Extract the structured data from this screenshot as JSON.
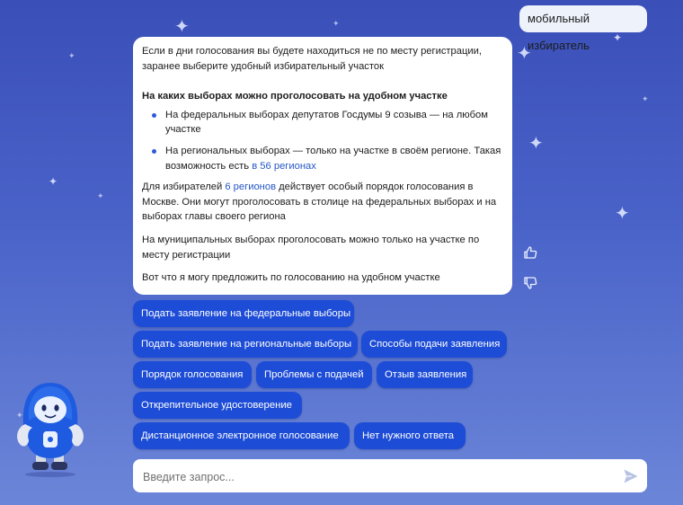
{
  "user_message": "мобильный избиратель",
  "bot_message": {
    "intro": "Если в дни голосования вы будете находиться не по месту регистрации, заранее выберите удобный избирательный участок",
    "subheading": "На каких выборах можно проголосовать на удобном участке",
    "bullets": [
      {
        "text": "На федеральных выборах депутатов Госдумы 9 созыва — на любом участке"
      },
      {
        "text": "На региональных выборах — только на участке в своём регионе. Такая возможность есть ",
        "link": "в 56 регионах"
      }
    ],
    "para1_before": "Для избирателей ",
    "para1_link": "6 регионов",
    "para1_after": " действует особый порядок голосования в Москве. Они могут проголосовать в столице на федеральных выборах и на выборах главы своего региона",
    "para2": "На муниципальных выборах проголосовать можно только на участке по месту регистрации",
    "para3": "Вот что я могу предложить по голосованию на удобном участке"
  },
  "suggestions": [
    "Подать заявление на федеральные выборы",
    "Подать заявление на региональные выборы",
    "Способы подачи заявления",
    "Порядок голосования",
    "Проблемы с подачей",
    "Отзыв заявления",
    "Открепительное удостоверение",
    "Дистанционное электронное голосование",
    "Нет нужного ответа"
  ],
  "input": {
    "placeholder": "Введите запрос..."
  },
  "icons": {
    "like": "thumbs-up-icon",
    "dislike": "thumbs-down-icon",
    "send": "send-icon",
    "mascot": "robot-mascot"
  },
  "colors": {
    "background_top": "#3a4fb8",
    "background_bottom": "#6b86d8",
    "chip": "#1d4cd6",
    "link": "#2457c5",
    "bullet": "#2e5bd8"
  }
}
